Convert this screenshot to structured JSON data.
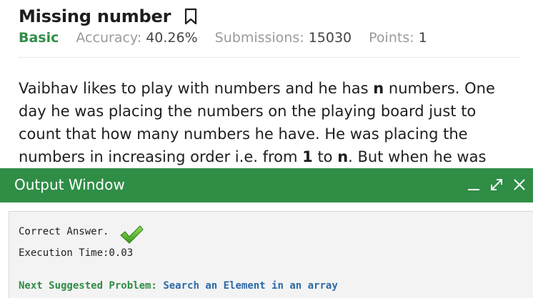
{
  "problem": {
    "title": "Missing number",
    "difficulty": "Basic",
    "accuracy_label": "Accuracy:",
    "accuracy_value": "40.26%",
    "submissions_label": "Submissions:",
    "submissions_value": "15030",
    "points_label": "Points:",
    "points_value": "1",
    "description": [
      {
        "text": "Vaibhav likes to play with numbers and he has ",
        "bold": false
      },
      {
        "text": "n",
        "bold": true
      },
      {
        "text": " numbers. One day he was placing the numbers on the playing board just to count that how many numbers he have. He was placing the numbers in increasing order i.e. from ",
        "bold": false
      },
      {
        "text": "1",
        "bold": true
      },
      {
        "text": " to ",
        "bold": false
      },
      {
        "text": "n",
        "bold": true
      },
      {
        "text": ". But when he was",
        "bold": false
      }
    ]
  },
  "output_window": {
    "title": "Output Window",
    "result_text": "Correct Answer.",
    "execution_time": "Execution Time:0.03",
    "next_label": "Next Suggested Problem:",
    "next_link": "Search an Element in an array"
  },
  "icons": {
    "bookmark": "bookmark-icon",
    "minimize": "minimize-icon",
    "expand": "expand-icon",
    "close": "close-icon",
    "check": "checkmark-icon"
  },
  "colors": {
    "accent_green": "#2f8d46",
    "link_blue": "#2d6aa6",
    "output_bg": "#f3f3f3"
  }
}
